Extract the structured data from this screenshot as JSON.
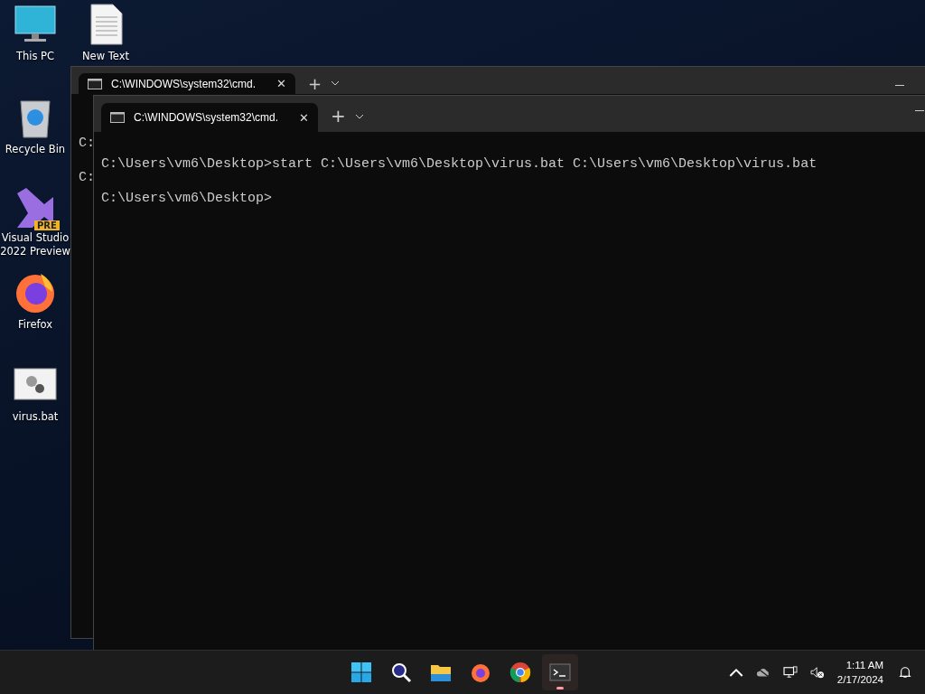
{
  "desktop_icons": [
    {
      "label": "This PC",
      "kind": "pc"
    },
    {
      "label": "New Text",
      "kind": "text"
    },
    {
      "label": "Recycle Bin",
      "kind": "bin"
    },
    {
      "label": "Visual Studio 2022 Preview",
      "kind": "vs",
      "badge": "PRE"
    },
    {
      "label": "Firefox",
      "kind": "firefox"
    },
    {
      "label": "virus.bat",
      "kind": "bat"
    }
  ],
  "back_window": {
    "tab": {
      "title": "C:\\WINDOWS\\system32\\cmd.",
      "close": "✕"
    },
    "new_tab": "+",
    "lines": [
      "C:",
      "C:"
    ]
  },
  "front_window": {
    "tab": {
      "title": "C:\\WINDOWS\\system32\\cmd.",
      "close": "✕"
    },
    "new_tab": "+",
    "lines": [
      "C:\\Users\\vm6\\Desktop>start C:\\Users\\vm6\\Desktop\\virus.bat C:\\Users\\vm6\\Desktop\\virus.bat",
      "C:\\Users\\vm6\\Desktop>"
    ]
  },
  "taskbar": {
    "apps": [
      {
        "kind": "start",
        "selected": false
      },
      {
        "kind": "search",
        "selected": false
      },
      {
        "kind": "folder",
        "selected": false
      },
      {
        "kind": "firefox",
        "selected": false
      },
      {
        "kind": "chrome",
        "selected": false
      },
      {
        "kind": "terminal",
        "selected": true
      }
    ],
    "clock": {
      "time": "1:11 AM",
      "date": "2/17/2024"
    }
  }
}
